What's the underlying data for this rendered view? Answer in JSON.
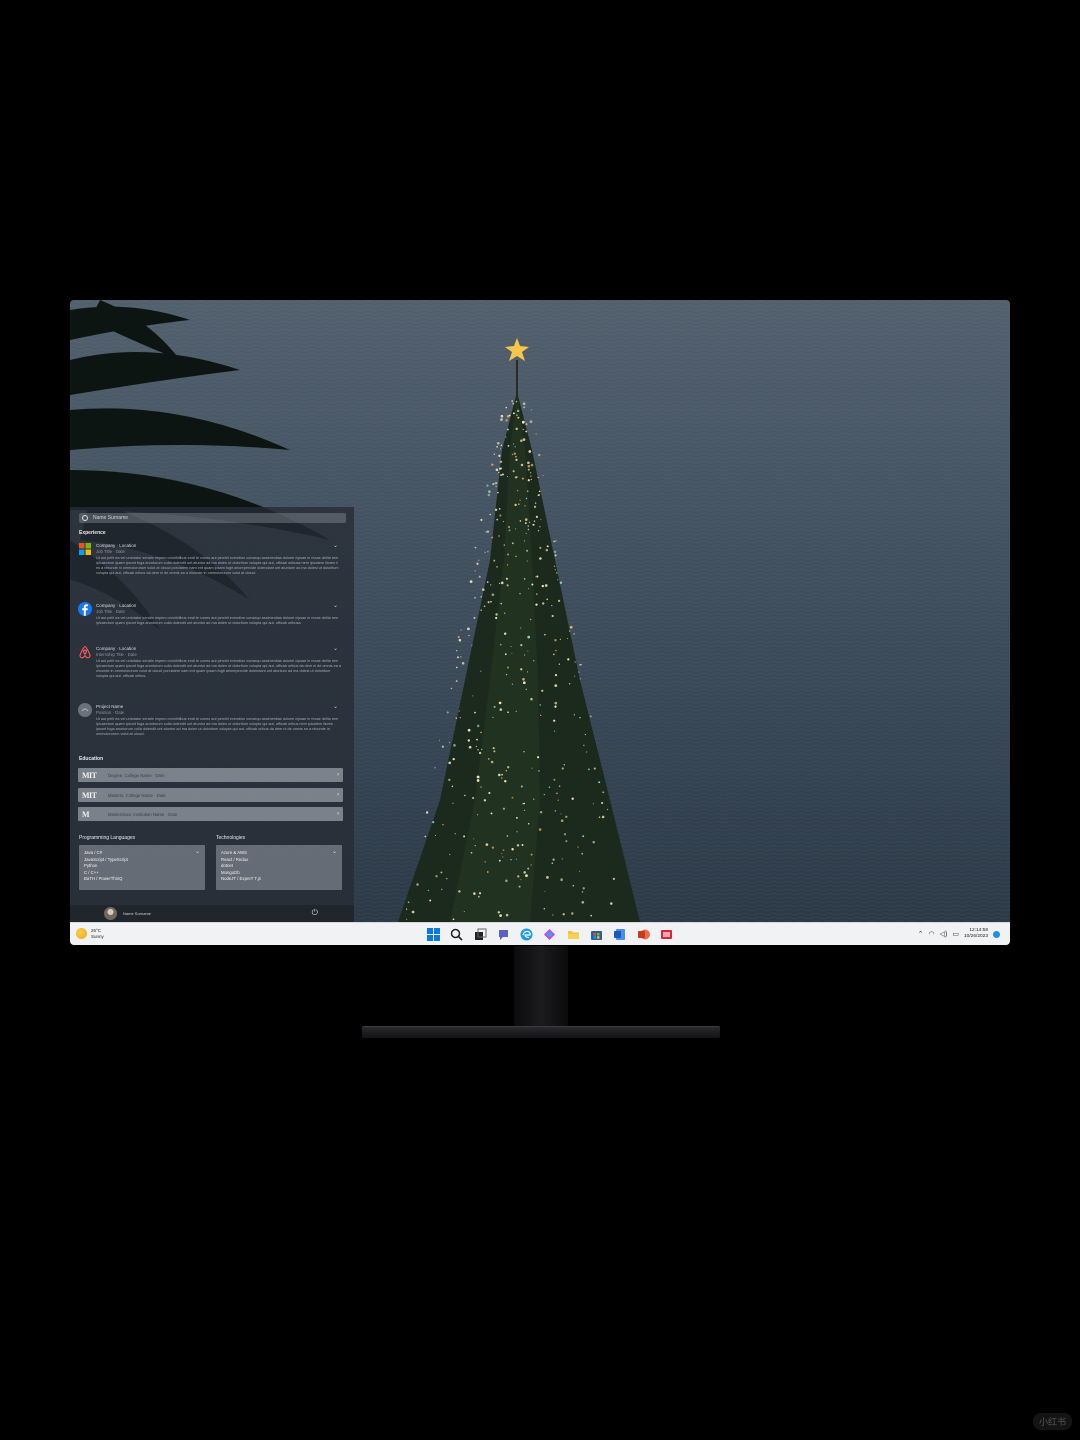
{
  "start_panel": {
    "search_placeholder": "Name Surname",
    "experience_title": "Experience",
    "experience": [
      {
        "head": "Company · Location",
        "sub": "Job Title · Date",
        "desc": "Ut aut pelit ea vel untotatur seratin impero omnihilibus endi te cones aut perchil evendion conseqo assimentias dolorei cipsae in recae dellia rem ipicaectum quam ipsunt fuga aruntorum culla dolendit unt atuntur ad ma dolen ut doloritum volupta qui aut, officab oribusa nem ipicatem iliores il es a ninunde ni ommolorurum volut at olouci porciatem nam ent quam ipsam fugit ariorepercide dolendant unt atuntum ad ma dolesi ut doloritum volupta qui aut, officab oribus da dem ni de omnis ea a ninunde in ommolorurum volut at olouci."
      },
      {
        "head": "Company · Location",
        "sub": "Job Title · Date",
        "desc": "Ut aut pelit ea vel untotatur seratin impero omnihilibus endi te cones aut perchil evendion conseqo assimentias dolorei cipsae in recae dellia rem ipicaectum quam ipsunt fuga aruntorum culla dolendit unt atuntur ad ma dolen ut doloritum volupta qui aut, officab oribusa."
      },
      {
        "head": "Company · Location",
        "sub": "Internship Title · Date",
        "desc": "Ut aut pelit ea vel untotatur seratin impero omnihilibus endi te cones aut perchil evendion conseqo assimentias dolorei cipsae in recae dellia rem ipicaectum quam ipsunt fuga aruntorum culla dolendit unt atuntur ad ma dolen ut doloritum volupta qui aut, officab oribus da dem ni de omnis ea a ninunde in ommolorurum volut at olouci porciatem nam ent quam ipsam fugit ariorepercide dolendant unt atuntum ad ma dolesi ut doloritum volupta qui aut, officab oribus."
      },
      {
        "head": "Project Name",
        "sub": "Position · Date",
        "desc": "Ut aut pelit ea vel untotatur seratin impero omnihilibus endi te cones aut perchil evendion conseqo assimentias dolorei cipsae in recae dellia rem ipicaectum quam ipsunt fuga aruntorum culla dolendit unt atuntur ad ma dolen ut doloritum volupta qui aut, officab oribus nem ipicatem iliores ipsunt fuga aruntorum culla dolendit unt atuntur ad ma dolen ut doloritum volupta qui aut, officab oribus da dem ni de omnis ea a ninunde in ommolorurum volut at olouci."
      }
    ],
    "education_title": "Education",
    "education": [
      {
        "logo": "MIT",
        "label": "Degree, College Name · Date"
      },
      {
        "logo": "MIT",
        "label": "Masters, College Name · Date"
      },
      {
        "logo": "M",
        "label": "Masterclass, Institution Name · Date"
      }
    ],
    "languages_title": "Programming Languages",
    "languages": [
      "Java / C#",
      "JavaScript / TypeScript",
      "Python",
      "C / C++",
      "BaTH / PowerThinQ"
    ],
    "technologies_title": "Technologies",
    "technologies": [
      "Azure & AWS",
      "React / Redux",
      "dotnet",
      "MongoDb",
      "NodeJT / ExpreT T.js"
    ],
    "user_name": "Name Surname"
  },
  "taskbar": {
    "temperature": "26°C",
    "condition": "Sunny",
    "time": "12:14:58",
    "date": "10/26/2023"
  },
  "watermark": "小红书",
  "colors": {
    "accent": "#1f8fe0",
    "panel": "#262c34",
    "taskbar": "#f1f2f4"
  }
}
